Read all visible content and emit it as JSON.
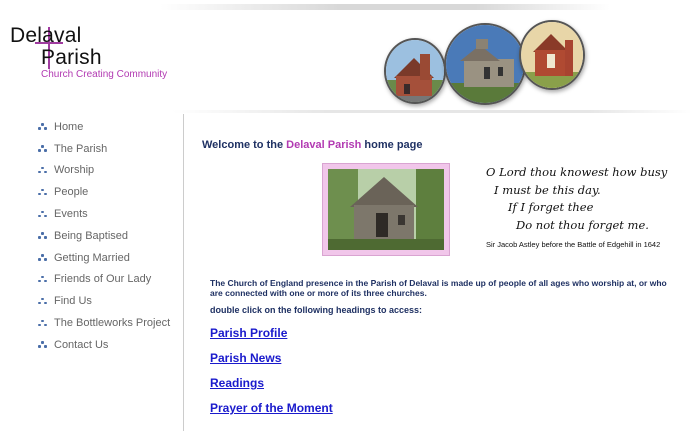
{
  "logo": {
    "line1": "Delaval",
    "line2": "Parish",
    "tagline": "Church Creating Community"
  },
  "nav": {
    "items": [
      {
        "label": "Home"
      },
      {
        "label": "The Parish"
      },
      {
        "label": "Worship"
      },
      {
        "label": "People"
      },
      {
        "label": "Events"
      },
      {
        "label": "Being Baptised"
      },
      {
        "label": "Getting Married"
      },
      {
        "label": "Friends of Our Lady"
      },
      {
        "label": "Find Us"
      },
      {
        "label": "The Bottleworks Project"
      },
      {
        "label": "Contact Us"
      }
    ]
  },
  "main": {
    "welcome_pre": "Welcome to the ",
    "welcome_accent": "Delaval Parish",
    "welcome_post": " home page",
    "prayer": [
      "O Lord thou knowest how busy",
      "I must be this day.",
      "If I forget thee",
      "Do not thou forget me."
    ],
    "attribution": "Sir Jacob Astley before the Battle of Edgehill in 1642",
    "intro": "The Church of England presence in the Parish of Delaval is made up of people of all ages who worship at, or who are connected with one or more of its three churches.",
    "instruction": "double click on the following headings to access:",
    "links": [
      {
        "label": "Parish Profile"
      },
      {
        "label": "Parish News"
      },
      {
        "label": "Readings"
      },
      {
        "label": "Prayer of the Moment"
      }
    ]
  },
  "colors": {
    "accent": "#b23ab2",
    "heading": "#1f3163",
    "link": "#1a1acc",
    "nav_text": "#666666",
    "nav_bullet": "#4a6ea8"
  }
}
